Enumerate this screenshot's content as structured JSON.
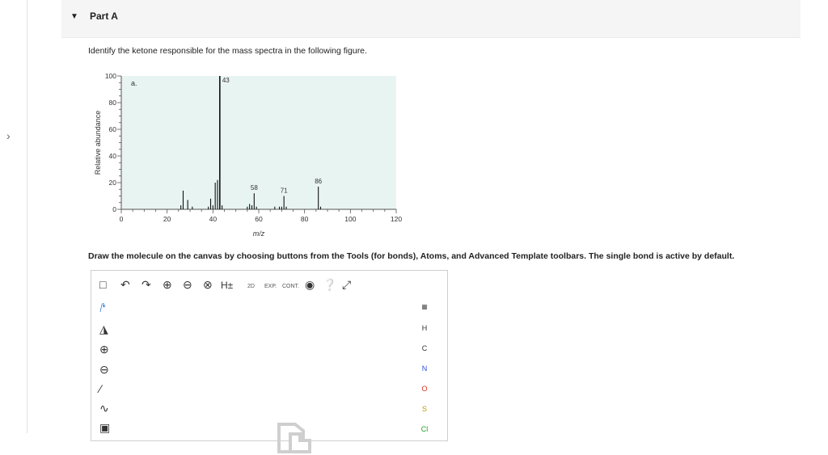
{
  "part": {
    "title": "Part A"
  },
  "question": "Identify the ketone responsible for the mass spectra in the following figure.",
  "chart_data": {
    "type": "bar",
    "panel_label": "a.",
    "xlabel": "m/z",
    "ylabel": "Relative abundance",
    "xlim": [
      0,
      120
    ],
    "ylim": [
      0,
      100
    ],
    "xticks": [
      0,
      20,
      40,
      60,
      80,
      100,
      120
    ],
    "yticks": [
      0,
      20,
      40,
      60,
      80,
      100
    ],
    "peaks": [
      {
        "x": 26,
        "y": 3
      },
      {
        "x": 27,
        "y": 14
      },
      {
        "x": 29,
        "y": 7
      },
      {
        "x": 31,
        "y": 2
      },
      {
        "x": 38,
        "y": 2
      },
      {
        "x": 39,
        "y": 8
      },
      {
        "x": 40,
        "y": 3
      },
      {
        "x": 41,
        "y": 20
      },
      {
        "x": 42,
        "y": 22
      },
      {
        "x": 43,
        "y": 100
      },
      {
        "x": 44,
        "y": 3
      },
      {
        "x": 55,
        "y": 2
      },
      {
        "x": 56,
        "y": 4
      },
      {
        "x": 57,
        "y": 3
      },
      {
        "x": 58,
        "y": 12
      },
      {
        "x": 59,
        "y": 2
      },
      {
        "x": 67,
        "y": 2
      },
      {
        "x": 69,
        "y": 2
      },
      {
        "x": 70,
        "y": 2
      },
      {
        "x": 71,
        "y": 10
      },
      {
        "x": 72,
        "y": 2
      },
      {
        "x": 86,
        "y": 17
      },
      {
        "x": 87,
        "y": 2
      }
    ],
    "labeled_peaks": [
      {
        "x": 43,
        "label": "43"
      },
      {
        "x": 58,
        "label": "58"
      },
      {
        "x": 71,
        "label": "71"
      },
      {
        "x": 86,
        "label": "86"
      }
    ],
    "background": "#e8f4f2",
    "bar_color": "#111111"
  },
  "instructions": "Draw the molecule on the canvas by choosing buttons from the Tools (for bonds), Atoms, and Advanced Template toolbars. The single bond is active by default.",
  "toolbar": {
    "hplus": "H±",
    "twod": "2D",
    "exp": "EXP.",
    "cont": "CONT."
  },
  "atoms": [
    {
      "symbol": "H",
      "color": "#333333"
    },
    {
      "symbol": "C",
      "color": "#333333"
    },
    {
      "symbol": "N",
      "color": "#2a4fd6"
    },
    {
      "symbol": "O",
      "color": "#e0301e"
    },
    {
      "symbol": "S",
      "color": "#b59a00"
    },
    {
      "symbol": "Cl",
      "color": "#1f9d1f"
    }
  ],
  "icons": {
    "new": "new-document-icon",
    "undo": "undo-icon",
    "redo": "redo-icon",
    "zoom_in": "zoom-in-icon",
    "zoom_out": "zoom-out-icon",
    "reset": "zoom-reset-icon",
    "info": "info-icon",
    "help": "help-icon",
    "fullscreen": "expand-icon",
    "periodic": "periodic-table-icon"
  }
}
